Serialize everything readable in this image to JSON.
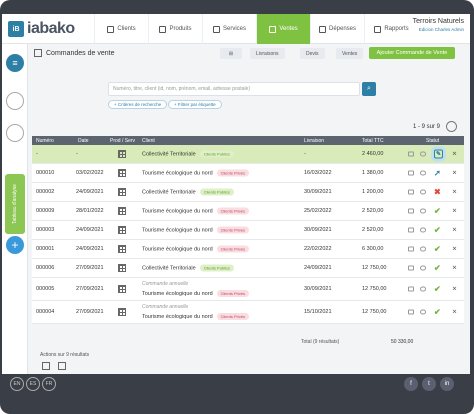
{
  "app": {
    "logo_text": "iabako",
    "logo_mark": "iB"
  },
  "nav": [
    {
      "label": "Clients",
      "active": false
    },
    {
      "label": "Produits",
      "active": false
    },
    {
      "label": "Services",
      "active": false
    },
    {
      "label": "Ventes",
      "active": true
    },
    {
      "label": "Dépenses",
      "active": false
    },
    {
      "label": "Rapports",
      "active": false
    }
  ],
  "user": {
    "name": "Terroirs Naturels",
    "subtitle": "Edicion Charles Admin"
  },
  "sidebar": {
    "vertical_tab": "Tableau d'analyse",
    "add_symbol": "+"
  },
  "page": {
    "title": "Commandes de vente",
    "view_buttons": [
      "Livraisons",
      "Devis",
      "Ventes"
    ],
    "add_button": "Ajouter Commande de Vente",
    "search_placeholder": "Numéro, titre, client (id, nom, prénom, email, adresse postale)",
    "search_icon": "search-icon",
    "chips": [
      "+ Critères de recherche",
      "+ Filtrer par étiquette"
    ],
    "pager": "1 - 9 sur 9",
    "menu_icon": "≡",
    "view_toggle_icon": "⊞"
  },
  "colors": {
    "accent": "#7fc241",
    "brand": "#2d7fa6",
    "header": "#5c6470"
  },
  "table": {
    "columns": [
      "Numéro",
      "Date",
      "Prod / Serv",
      "Client",
      "Livraison",
      "Total TTC",
      "Statut"
    ],
    "rows": [
      {
        "numero": "-",
        "date": "-",
        "client_note": "",
        "client": "Collectivité Territoriale",
        "badge": "Clients Publics",
        "badge_type": "public",
        "livraison": "-",
        "total": "2 460,00",
        "status": "edit",
        "highlight": true
      },
      {
        "numero": "000010",
        "date": "03/02/2022",
        "client_note": "",
        "client": "Tourisme écologique du nord",
        "badge": "Clients Privés",
        "badge_type": "private",
        "livraison": "16/03/2022",
        "total": "1 380,00",
        "status": "arrow",
        "highlight": false
      },
      {
        "numero": "000002",
        "date": "24/09/2021",
        "client_note": "",
        "client": "Collectivité Territoriale",
        "badge": "Clients Publics",
        "badge_type": "public",
        "livraison": "30/09/2021",
        "total": "1 200,00",
        "status": "cancel",
        "highlight": false
      },
      {
        "numero": "000009",
        "date": "28/01/2022",
        "client_note": "",
        "client": "Tourisme écologique du nord",
        "badge": "Clients Privés",
        "badge_type": "private",
        "livraison": "25/02/2022",
        "total": "2 520,00",
        "status": "check",
        "highlight": false
      },
      {
        "numero": "000003",
        "date": "24/09/2021",
        "client_note": "",
        "client": "Tourisme écologique du nord",
        "badge": "Clients Privés",
        "badge_type": "private",
        "livraison": "30/09/2021",
        "total": "2 520,00",
        "status": "check",
        "highlight": false
      },
      {
        "numero": "000001",
        "date": "24/09/2021",
        "client_note": "",
        "client": "Tourisme écologique du nord",
        "badge": "Clients Privés",
        "badge_type": "private",
        "livraison": "22/02/2022",
        "total": "6 300,00",
        "status": "check",
        "highlight": false
      },
      {
        "numero": "000006",
        "date": "27/09/2021",
        "client_note": "",
        "client": "Collectivité Territoriale",
        "badge": "Clients Publics",
        "badge_type": "public",
        "livraison": "24/09/2021",
        "total": "12 750,00",
        "status": "check",
        "highlight": false
      },
      {
        "numero": "000005",
        "date": "27/09/2021",
        "client_note": "Commande annuelle",
        "client": "Tourisme écologique du nord",
        "badge": "Clients Privés",
        "badge_type": "private",
        "livraison": "30/09/2021",
        "total": "12 750,00",
        "status": "check",
        "highlight": false
      },
      {
        "numero": "000004",
        "date": "27/09/2021",
        "client_note": "Commande annuelle",
        "client": "Tourisme écologique du nord",
        "badge": "Clients Privés",
        "badge_type": "private",
        "livraison": "15/10/2021",
        "total": "12 750,00",
        "status": "check",
        "highlight": false
      }
    ]
  },
  "totals": {
    "label": "Total (9 résultats)",
    "value": "50 330,00"
  },
  "footer": {
    "actions_label": "Actions sur 9 résultats"
  },
  "languages": [
    "EN",
    "ES",
    "FR"
  ],
  "social": [
    "f",
    "t",
    "in"
  ]
}
